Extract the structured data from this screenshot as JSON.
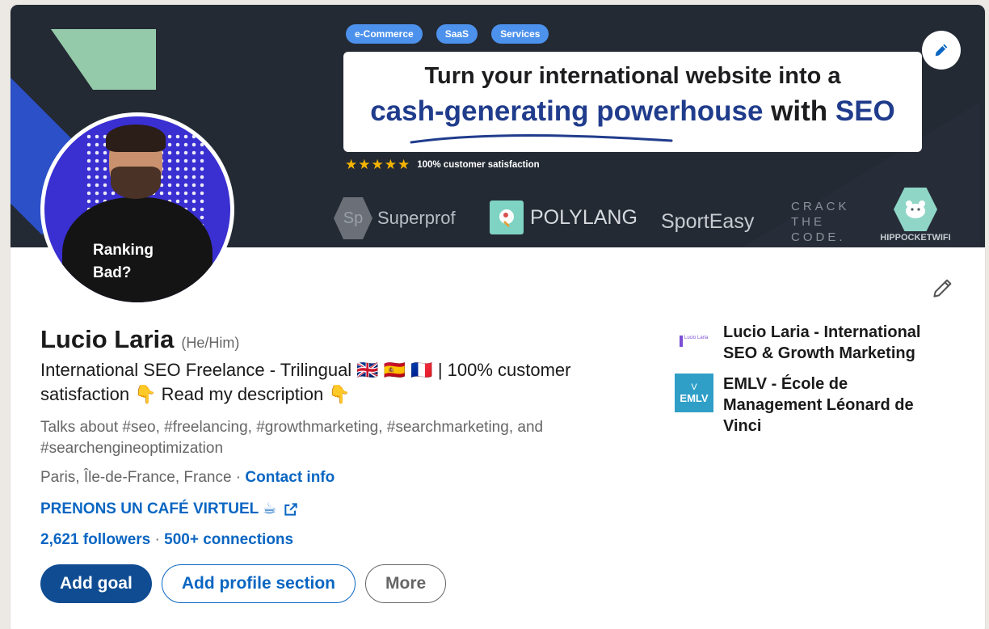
{
  "banner": {
    "tags": [
      "e-Commerce",
      "SaaS",
      "Services"
    ],
    "headline_line1": "Turn your international website into a",
    "headline_line2_blue": "cash-generating powerhouse",
    "headline_line2_mid": " with ",
    "headline_line2_end": "SEO",
    "stars": "★★★★★",
    "rating_text": "100% customer satisfaction",
    "logos": {
      "superprof_mark": "Sp",
      "superprof": "Superprof",
      "polylang": "POLYLANG",
      "sporteasy": "SportEasy",
      "crack_line1": "CRACK",
      "crack_line2": "THE",
      "crack_line3": "CODE.",
      "hippo": "HIPPOCKETWIFI"
    }
  },
  "avatar": {
    "shirt_line1": "Ranking",
    "shirt_line2": "Bad?"
  },
  "profile": {
    "name": "Lucio Laria",
    "pronouns": "(He/Him)",
    "headline": "International SEO Freelance - Trilingual 🇬🇧 🇪🇸 🇫🇷 | 100% customer satisfaction 👇 Read my description 👇",
    "talks_about": "Talks about #seo, #freelancing, #growthmarketing, #searchmarketing, and #searchengineoptimization",
    "location": "Paris, Île-de-France, France",
    "separator": " · ",
    "contact_info": "Contact info",
    "website": "PRENONS UN CAFÉ VIRTUEL ☕",
    "followers": "2,621 followers",
    "connections": "500+ connections"
  },
  "actions": {
    "add_goal": "Add goal",
    "add_profile_section": "Add profile section",
    "more": "More"
  },
  "right_column": {
    "items": [
      {
        "name": "Lucio Laria - International SEO & Growth Marketing",
        "logo_text": "Lucio Laria"
      },
      {
        "name": "EMLV - École de Management Léonard de Vinci",
        "logo_text": "EMLV",
        "logo_mark": "V"
      }
    ]
  },
  "colors": {
    "link": "#0a66c2",
    "primary_button": "#0f4c92",
    "banner_bg": "#232a34"
  }
}
